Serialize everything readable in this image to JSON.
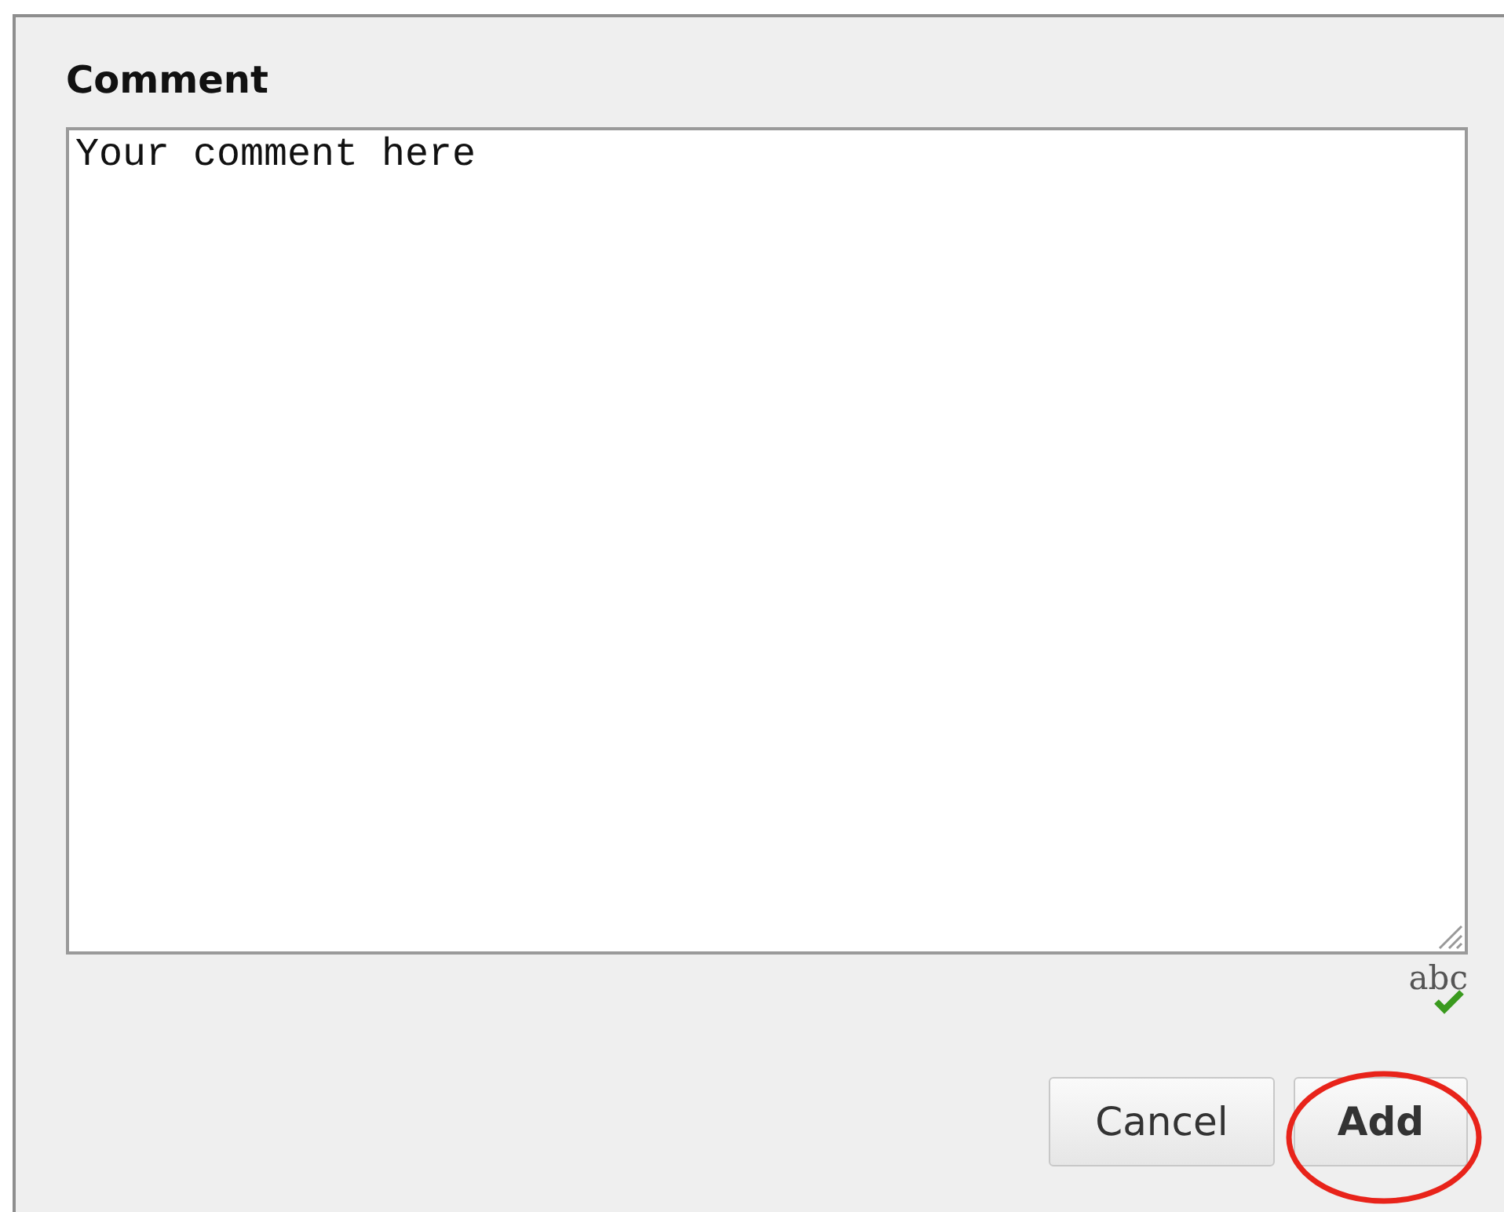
{
  "panel": {
    "title": "Comment"
  },
  "comment_box": {
    "value": "Your comment here"
  },
  "spellcheck": {
    "label": "abc",
    "on": true
  },
  "buttons": [
    {
      "label": "Cancel",
      "circled": false
    },
    {
      "label": "Add",
      "circled": true
    }
  ]
}
